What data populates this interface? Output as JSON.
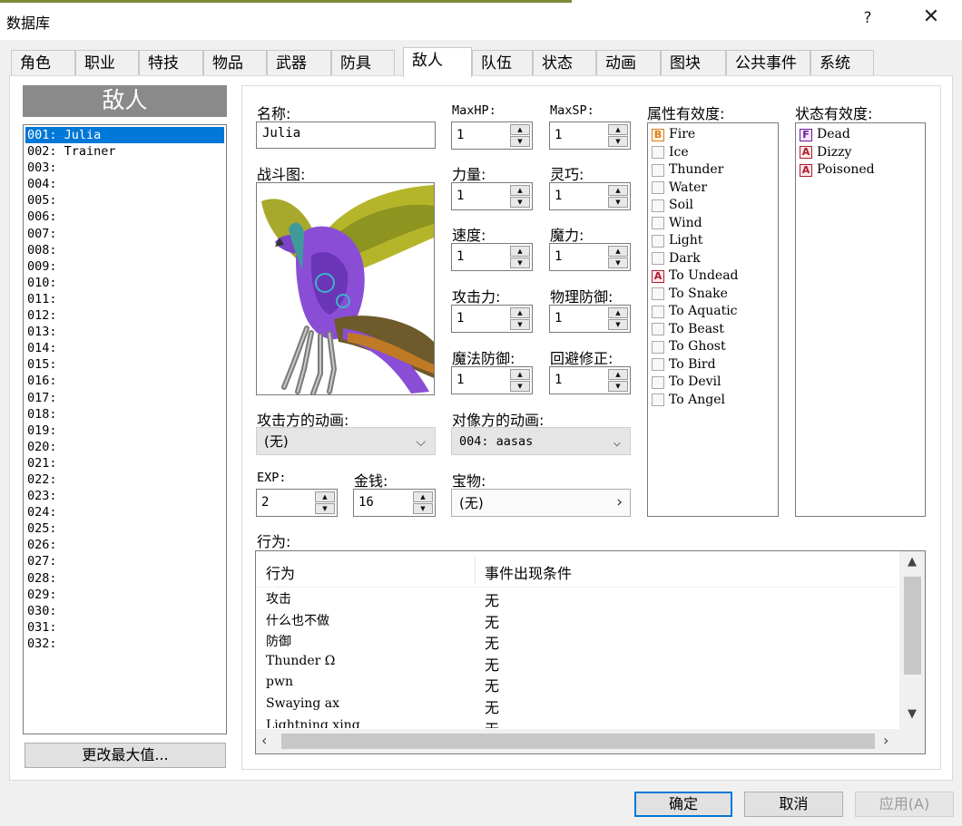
{
  "window": {
    "title": "数据库",
    "help_glyph": "?",
    "close_glyph": "✕"
  },
  "tabs": [
    "角色",
    "职业",
    "特技",
    "物品",
    "武器",
    "防具",
    "敌人",
    "队伍",
    "状态",
    "动画",
    "图块",
    "公共事件",
    "系统"
  ],
  "active_tab": "敌人",
  "sidebar": {
    "heading": "敌人",
    "items": [
      "001: Julia",
      "002: Trainer",
      "003:",
      "004:",
      "005:",
      "006:",
      "007:",
      "008:",
      "009:",
      "010:",
      "011:",
      "012:",
      "013:",
      "014:",
      "015:",
      "016:",
      "017:",
      "018:",
      "019:",
      "020:",
      "021:",
      "022:",
      "023:",
      "024:",
      "025:",
      "026:",
      "027:",
      "028:",
      "029:",
      "030:",
      "031:",
      "032:"
    ],
    "selected_index": 0,
    "change_max_button": "更改最大值..."
  },
  "form": {
    "name_label": "名称:",
    "name_value": "Julia",
    "battler_label": "战斗图:",
    "maxhp_label": "MaxHP:",
    "maxhp_value": "1",
    "maxsp_label": "MaxSP:",
    "maxsp_value": "1",
    "str_label": "力量:",
    "str_value": "1",
    "dex_label": "灵巧:",
    "dex_value": "1",
    "agi_label": "速度:",
    "agi_value": "1",
    "int_label": "魔力:",
    "int_value": "1",
    "atk_label": "攻击力:",
    "atk_value": "1",
    "pdef_label": "物理防御:",
    "pdef_value": "1",
    "mdef_label": "魔法防御:",
    "mdef_value": "1",
    "eva_label": "回避修正:",
    "eva_value": "1",
    "attacker_anim_label": "攻击方的动画:",
    "attacker_anim_value": "(无)",
    "target_anim_label": "对像方的动画:",
    "target_anim_value": "004: aasas",
    "exp_label": "EXP:",
    "exp_value": "2",
    "gold_label": "金钱:",
    "gold_value": "16",
    "treasure_label": "宝物:",
    "treasure_value": "(无)",
    "element_label": "属性有效度:",
    "state_label": "状态有效度:",
    "actions_label": "行为:"
  },
  "elements": [
    {
      "mark": "B",
      "name": "Fire"
    },
    {
      "mark": "",
      "name": "Ice"
    },
    {
      "mark": "",
      "name": "Thunder"
    },
    {
      "mark": "",
      "name": "Water"
    },
    {
      "mark": "",
      "name": "Soil"
    },
    {
      "mark": "",
      "name": "Wind"
    },
    {
      "mark": "",
      "name": "Light"
    },
    {
      "mark": "",
      "name": "Dark"
    },
    {
      "mark": "A",
      "name": "To Undead"
    },
    {
      "mark": "",
      "name": "To Snake"
    },
    {
      "mark": "",
      "name": "To Aquatic"
    },
    {
      "mark": "",
      "name": "To Beast"
    },
    {
      "mark": "",
      "name": "To Ghost"
    },
    {
      "mark": "",
      "name": "To Bird"
    },
    {
      "mark": "",
      "name": "To Devil"
    },
    {
      "mark": "",
      "name": "To Angel"
    }
  ],
  "states": [
    {
      "mark": "F",
      "name": "Dead"
    },
    {
      "mark": "A",
      "name": "Dizzy"
    },
    {
      "mark": "A",
      "name": "Poisoned"
    }
  ],
  "actions": {
    "col_action": "行为",
    "col_condition": "事件出现条件",
    "rows": [
      {
        "action": "攻击",
        "condition": "无"
      },
      {
        "action": "什么也不做",
        "condition": "无"
      },
      {
        "action": "防御",
        "condition": "无"
      },
      {
        "action": "Thunder Ω",
        "condition": "无"
      },
      {
        "action": "pwn",
        "condition": "无"
      },
      {
        "action": "Swaying ax",
        "condition": "无"
      },
      {
        "action": "Lightning xing",
        "condition": "无"
      }
    ]
  },
  "buttons": {
    "ok": "确定",
    "cancel": "取消",
    "apply": "应用(A)"
  },
  "colors": {
    "selection": "#0078d7",
    "mark_B": "#d47f1e",
    "mark_A": "#b01c2e",
    "mark_F": "#6a1b9a"
  }
}
